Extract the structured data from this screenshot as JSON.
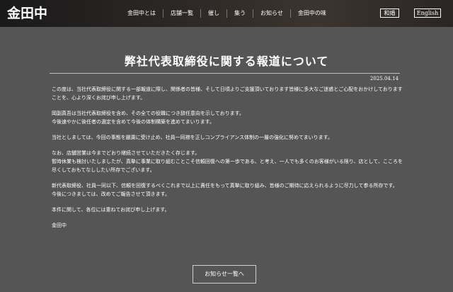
{
  "header": {
    "logo": "金田中",
    "nav": [
      {
        "label": "金田中とは"
      },
      {
        "label": "店舗一覧"
      },
      {
        "label": "催し"
      },
      {
        "label": "集う"
      },
      {
        "label": "お知らせ"
      },
      {
        "label": "金田中の味"
      }
    ],
    "lang_ja": "和婚",
    "lang_en": "English"
  },
  "article": {
    "title": "弊社代表取締役に関する報道について",
    "date": "2025.04.14",
    "paragraphs": [
      [
        "この度は、当社代表取締役に関する一部報道に際し、関係者の皆様、そして日頃よりご支援頂いております皆様に多大なご迷惑とご心配をおかけしておりますことを、心より深くお詫び申し上げます。"
      ],
      [
        "岡副真吾は当社代表取締役を含め、その全ての役職につき辞任意向を示しております。",
        "今後速やかに後任者の選定を含めて今後の体制構築を進めてまいります。"
      ],
      [
        "当社としましては、今回の事態を厳粛に受け止め、社員一同襟を正しコンプライアンス体制の一層の強化に努めてまいります。"
      ],
      [
        "なお、店舗営業は今までどおり継続させていただきたく存じます。",
        "暫時休業も検討いたしましたが、真摯に事業に取り組むことこそ信頼回復への第一歩である、と考え、一人でも多くのお客様がいる限り、店として、こころを尽くしておもてなししたい所存でございます。"
      ],
      [
        "新代表取締役、社員一同以下、信頼を回復するべくこれまで以上に責任をもって真摯に取り組み、皆様のご期待に応えられるように尽力して参る所存です。",
        "今後につきましては、改めてご報告させて頂きます。"
      ],
      [
        "本件に関して、各位には重ねてお詫び申し上げます。"
      ],
      [
        "金田中"
      ]
    ],
    "back_button": "お知らせ一覧へ"
  }
}
